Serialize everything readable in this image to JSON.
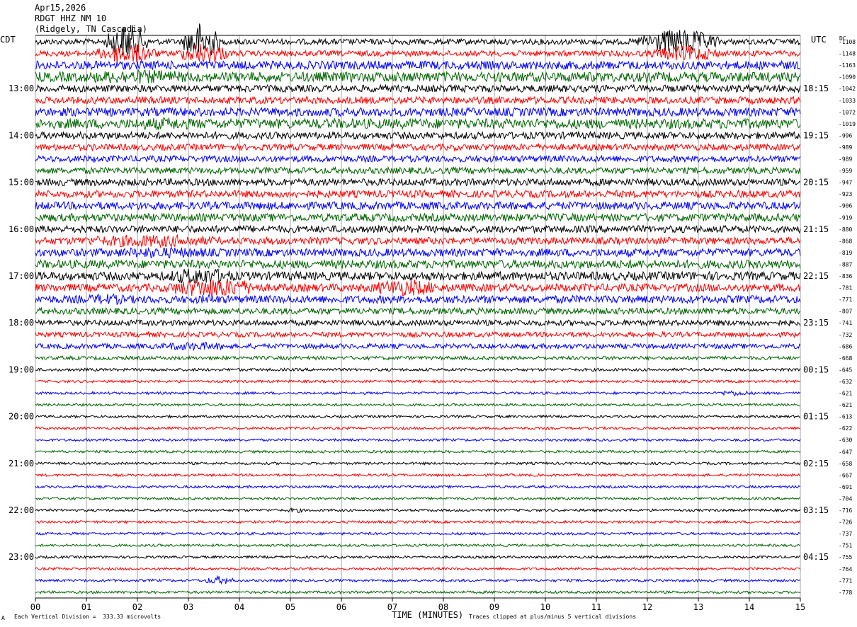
{
  "header": {
    "date": "Apr15,2026",
    "station": "RDGT HHZ NM 10",
    "location": "(Ridgely, TN Cascadia)"
  },
  "left_tz": "CDT",
  "right_tz": "UTC",
  "dc_label": "DC",
  "footer": {
    "left_marker": "A",
    "scale": "Each Vertical Division =  333.33 microvolts",
    "clip": "Traces clipped at plus/minus 5 vertical divisions"
  },
  "colors": {
    "trace": [
      "#000000",
      "#ff0000",
      "#0000ff",
      "#006400"
    ],
    "grid": "#808080"
  },
  "chart_data": {
    "type": "line",
    "title": "RDGT HHZ NM 10",
    "xlabel": "TIME (MINUTES)",
    "x_ticks": [
      "00",
      "01",
      "02",
      "03",
      "04",
      "05",
      "06",
      "07",
      "08",
      "09",
      "10",
      "11",
      "12",
      "13",
      "14",
      "15"
    ],
    "xlim": [
      0,
      15
    ],
    "row_count": 48,
    "left_hour_labels": [
      "13:00",
      "14:00",
      "15:00",
      "16:00",
      "17:00",
      "18:00",
      "19:00",
      "20:00",
      "21:00",
      "22:00",
      "23:00"
    ],
    "right_hour_labels": [
      "18:15",
      "19:15",
      "20:15",
      "21:15",
      "22:15",
      "23:15",
      "00:15",
      "01:15",
      "02:15",
      "03:15",
      "04:15"
    ],
    "dc_offsets": [
      -1108,
      -1148,
      -1163,
      -1090,
      -1042,
      -1033,
      -1072,
      -1019,
      -996,
      -989,
      -989,
      -959,
      -947,
      -923,
      -906,
      -919,
      -880,
      -868,
      -819,
      -887,
      -836,
      -781,
      -771,
      -807,
      -741,
      -732,
      -686,
      -668,
      -645,
      -632,
      -621,
      -621,
      -613,
      -622,
      -630,
      -647,
      -658,
      -667,
      -691,
      -704,
      -716,
      -726,
      -737,
      -751,
      -755,
      -764,
      -771,
      -778
    ],
    "row_amplitude": [
      8,
      8,
      12,
      14,
      10,
      10,
      12,
      14,
      10,
      9,
      9,
      9,
      10,
      10,
      11,
      11,
      10,
      10,
      11,
      12,
      12,
      11,
      11,
      9,
      8,
      7,
      7,
      5,
      4,
      3.5,
      3.5,
      3.5,
      3.5,
      3.5,
      3.5,
      3.5,
      3.5,
      3.5,
      3.5,
      3.5,
      3.5,
      3.5,
      3.5,
      3.5,
      3.5,
      3.5,
      3.5,
      3.5
    ],
    "events": [
      {
        "row": 0,
        "start": 1.4,
        "end": 2.2,
        "amp": 50
      },
      {
        "row": 0,
        "start": 2.9,
        "end": 3.6,
        "amp": 55
      },
      {
        "row": 0,
        "start": 11.8,
        "end": 13.4,
        "amp": 35
      },
      {
        "row": 1,
        "start": 1.2,
        "end": 2.4,
        "amp": 30
      },
      {
        "row": 1,
        "start": 2.8,
        "end": 3.8,
        "amp": 30
      },
      {
        "row": 1,
        "start": 12.0,
        "end": 13.5,
        "amp": 22
      },
      {
        "row": 3,
        "start": 0.5,
        "end": 3.5,
        "amp": 20
      },
      {
        "row": 7,
        "start": 1.5,
        "end": 3.5,
        "amp": 18
      },
      {
        "row": 17,
        "start": 0.5,
        "end": 4.0,
        "amp": 18
      },
      {
        "row": 18,
        "start": 1.0,
        "end": 4.0,
        "amp": 16
      },
      {
        "row": 20,
        "start": 2.5,
        "end": 4.0,
        "amp": 25
      },
      {
        "row": 21,
        "start": 2.5,
        "end": 4.5,
        "amp": 28
      },
      {
        "row": 21,
        "start": 6.5,
        "end": 8.0,
        "amp": 24
      },
      {
        "row": 22,
        "start": 0.8,
        "end": 2.0,
        "amp": 16
      },
      {
        "row": 22,
        "start": 3.0,
        "end": 3.8,
        "amp": 14
      },
      {
        "row": 26,
        "start": 2.2,
        "end": 4.0,
        "amp": 12
      },
      {
        "row": 30,
        "start": 13.3,
        "end": 14.1,
        "amp": 8
      },
      {
        "row": 40,
        "start": 4.9,
        "end": 5.3,
        "amp": 7
      },
      {
        "row": 46,
        "start": 3.3,
        "end": 3.9,
        "amp": 12
      }
    ]
  }
}
